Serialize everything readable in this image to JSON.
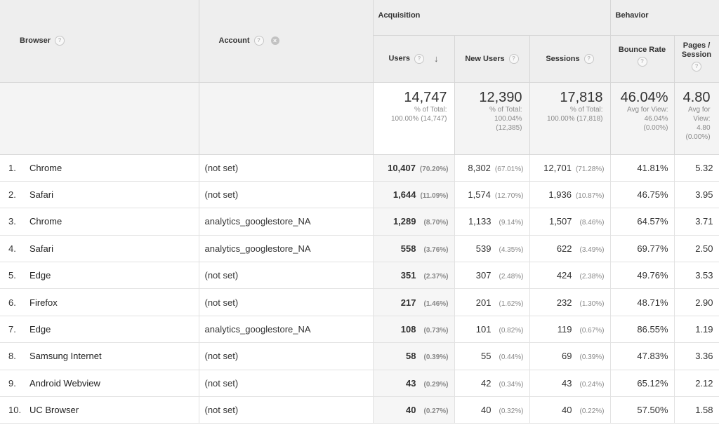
{
  "header": {
    "browser_label": "Browser",
    "account_label": "Account",
    "acquisition_label": "Acquisition",
    "behavior_label": "Behavior",
    "users_label": "Users",
    "new_users_label": "New Users",
    "sessions_label": "Sessions",
    "bounce_rate_label": "Bounce Rate",
    "pages_session_label_1": "Pages /",
    "pages_session_label_2": "Session",
    "help_glyph": "?"
  },
  "totals": {
    "users": {
      "value": "14,747",
      "sub1": "% of Total:",
      "sub2": "100.00% (14,747)"
    },
    "new_users": {
      "value": "12,390",
      "sub1": "% of Total:",
      "sub2": "100.04%",
      "sub3": "(12,385)"
    },
    "sessions": {
      "value": "17,818",
      "sub1": "% of Total:",
      "sub2": "100.00% (17,818)"
    },
    "bounce_rate": {
      "value": "46.04%",
      "sub1": "Avg for View:",
      "sub2": "46.04%",
      "sub3": "(0.00%)"
    },
    "pages_session": {
      "value": "4.80",
      "sub1": "Avg for",
      "sub2": "View:",
      "sub3": "4.80",
      "sub4": "(0.00%)"
    }
  },
  "rows": [
    {
      "n": "1.",
      "browser": "Chrome",
      "account": "(not set)",
      "users": "10,407",
      "users_pct": "(70.20%)",
      "new_users": "8,302",
      "new_users_pct": "(67.01%)",
      "sessions": "12,701",
      "sessions_pct": "(71.28%)",
      "bounce": "41.81%",
      "pages": "5.32"
    },
    {
      "n": "2.",
      "browser": "Safari",
      "account": "(not set)",
      "users": "1,644",
      "users_pct": "(11.09%)",
      "new_users": "1,574",
      "new_users_pct": "(12.70%)",
      "sessions": "1,936",
      "sessions_pct": "(10.87%)",
      "bounce": "46.75%",
      "pages": "3.95"
    },
    {
      "n": "3.",
      "browser": "Chrome",
      "account": "analytics_googlestore_NA",
      "users": "1,289",
      "users_pct": "(8.70%)",
      "new_users": "1,133",
      "new_users_pct": "(9.14%)",
      "sessions": "1,507",
      "sessions_pct": "(8.46%)",
      "bounce": "64.57%",
      "pages": "3.71"
    },
    {
      "n": "4.",
      "browser": "Safari",
      "account": "analytics_googlestore_NA",
      "users": "558",
      "users_pct": "(3.76%)",
      "new_users": "539",
      "new_users_pct": "(4.35%)",
      "sessions": "622",
      "sessions_pct": "(3.49%)",
      "bounce": "69.77%",
      "pages": "2.50"
    },
    {
      "n": "5.",
      "browser": "Edge",
      "account": "(not set)",
      "users": "351",
      "users_pct": "(2.37%)",
      "new_users": "307",
      "new_users_pct": "(2.48%)",
      "sessions": "424",
      "sessions_pct": "(2.38%)",
      "bounce": "49.76%",
      "pages": "3.53"
    },
    {
      "n": "6.",
      "browser": "Firefox",
      "account": "(not set)",
      "users": "217",
      "users_pct": "(1.46%)",
      "new_users": "201",
      "new_users_pct": "(1.62%)",
      "sessions": "232",
      "sessions_pct": "(1.30%)",
      "bounce": "48.71%",
      "pages": "2.90"
    },
    {
      "n": "7.",
      "browser": "Edge",
      "account": "analytics_googlestore_NA",
      "users": "108",
      "users_pct": "(0.73%)",
      "new_users": "101",
      "new_users_pct": "(0.82%)",
      "sessions": "119",
      "sessions_pct": "(0.67%)",
      "bounce": "86.55%",
      "pages": "1.19"
    },
    {
      "n": "8.",
      "browser": "Samsung Internet",
      "account": "(not set)",
      "users": "58",
      "users_pct": "(0.39%)",
      "new_users": "55",
      "new_users_pct": "(0.44%)",
      "sessions": "69",
      "sessions_pct": "(0.39%)",
      "bounce": "47.83%",
      "pages": "3.36"
    },
    {
      "n": "9.",
      "browser": "Android Webview",
      "account": "(not set)",
      "users": "43",
      "users_pct": "(0.29%)",
      "new_users": "42",
      "new_users_pct": "(0.34%)",
      "sessions": "43",
      "sessions_pct": "(0.24%)",
      "bounce": "65.12%",
      "pages": "2.12"
    },
    {
      "n": "10.",
      "browser": "UC Browser",
      "account": "(not set)",
      "users": "40",
      "users_pct": "(0.27%)",
      "new_users": "40",
      "new_users_pct": "(0.32%)",
      "sessions": "40",
      "sessions_pct": "(0.22%)",
      "bounce": "57.50%",
      "pages": "1.58"
    }
  ]
}
